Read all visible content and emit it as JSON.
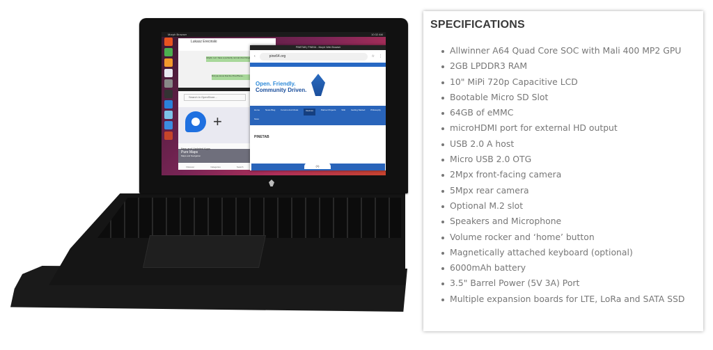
{
  "product_image": {
    "alt": "PineTab tablet with magnetic keyboard and cover",
    "screen": {
      "topbar_app": "Morph Browser",
      "topbar_status": "10:32 AM",
      "chat_window": {
        "contact_name": "Lukasz Erecinski",
        "messages": [
          "Alright, Let I have a perfectly normal chat things then",
          "Did you know that the PinePhone..."
        ]
      },
      "store_window": {
        "search_placeholder": "Search in OpenStore...",
        "featured_app": "Pure Maps",
        "featured_subtitle": "Maps and Navigation",
        "section": "New and Updated Apps",
        "tabs": [
          "Discover",
          "Categories",
          "Search"
        ]
      },
      "browser_window": {
        "title": "PINETAB | PINE64 - Morph Web Browser",
        "url": "pine64.org",
        "hero_line1": "Open. Friendly.",
        "hero_line2": "Community Driven.",
        "nav_items": [
          "Home",
          "News Blog",
          "Forums And Chats",
          "Devices",
          "Partner Projects",
          "Wiki",
          "Getting Started",
          "Philosophy",
          "Store"
        ],
        "active_nav": "Devices",
        "page_heading": "PINETAB",
        "tab_counter": "(1)"
      }
    }
  },
  "specs": {
    "title": "SPECIFICATIONS",
    "items": [
      "Allwinner A64 Quad Core SOC with Mali 400 MP2 GPU",
      "2GB LPDDR3 RAM",
      "10\" MiPi 720p Capacitive LCD",
      "Bootable Micro SD Slot",
      "64GB of eMMC",
      "microHDMI port for external HD output",
      "USB 2.0 A host",
      "Micro USB 2.0 OTG",
      "2Mpx front-facing camera",
      "5Mpx rear camera",
      "Optional M.2 slot",
      "Speakers and Microphone",
      "Volume rocker and ‘home’ button",
      "Magnetically attached keyboard (optional)",
      "6000mAh battery",
      "3.5\" Barrel Power (5V 3A) Port",
      "Multiple expansion boards for LTE, LoRa and SATA SSD"
    ]
  },
  "colors": {
    "ubuntu_orange": "#e95420",
    "pine_blue": "#2964ba",
    "spec_text": "#777777",
    "spec_title": "#3a3a3a"
  }
}
